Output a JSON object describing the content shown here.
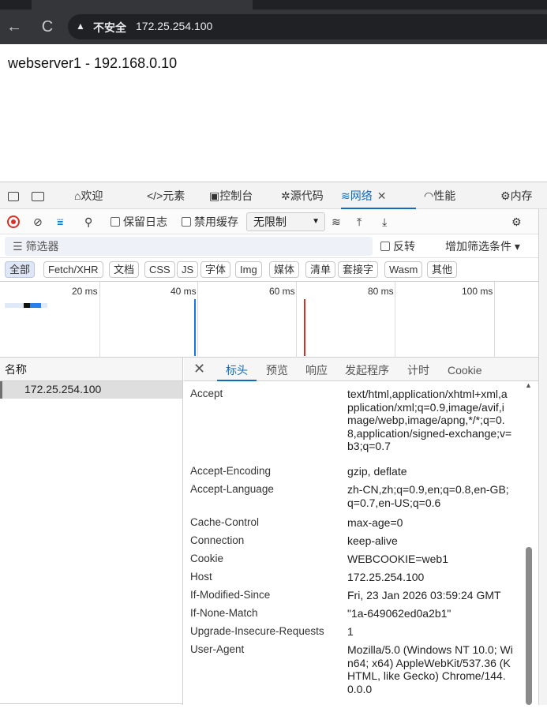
{
  "browser": {
    "back_glyph": "←",
    "reload_glyph": "C",
    "security_label": "不安全",
    "url": "172.25.254.100"
  },
  "page": {
    "text": "webserver1 - 192.168.0.10"
  },
  "devtools": {
    "tabs": [
      {
        "label": "欢迎"
      },
      {
        "label": "元素"
      },
      {
        "label": "控制台"
      },
      {
        "label": "源代码"
      },
      {
        "label": "网络",
        "active": true
      },
      {
        "label": "性能"
      },
      {
        "label": "内存"
      }
    ],
    "toolbar": {
      "preserve_log": "保留日志",
      "disable_cache": "禁用缓存",
      "throttle": "无限制"
    },
    "filter": {
      "placeholder": "筛选器",
      "invert": "反转",
      "more_filters": "增加筛选条件"
    },
    "type_filters": [
      "全部",
      "Fetch/XHR",
      "文档",
      "CSS",
      "JS",
      "字体",
      "Img",
      "媒体",
      "清单",
      "套接字",
      "Wasm",
      "其他"
    ],
    "overview_ticks": [
      "20 ms",
      "40 ms",
      "60 ms",
      "80 ms",
      "100 ms"
    ],
    "name_column_header": "名称",
    "requests": [
      "172.25.254.100"
    ],
    "detail_tabs": [
      "标头",
      "预览",
      "响应",
      "发起程序",
      "计时",
      "Cookie"
    ],
    "active_detail_tab": "标头",
    "headers": [
      {
        "name": "Accept",
        "value": "text/html,application/xhtml+xml,application/xml;q=0.9,image/avif,image/webp,image/apng,*/*;q=0.8,application/signed-exchange;v=b3;q=0.7"
      },
      {
        "name": "Accept-Encoding",
        "value": "gzip, deflate"
      },
      {
        "name": "Accept-Language",
        "value": "zh-CN,zh;q=0.9,en;q=0.8,en-GB;q=0.7,en-US;q=0.6"
      },
      {
        "name": "Cache-Control",
        "value": "max-age=0"
      },
      {
        "name": "Connection",
        "value": "keep-alive"
      },
      {
        "name": "Cookie",
        "value": "WEBCOOKIE=web1"
      },
      {
        "name": "Host",
        "value": "172.25.254.100"
      },
      {
        "name": "If-Modified-Since",
        "value": "Fri, 23 Jan 2026 03:59:24 GMT"
      },
      {
        "name": "If-None-Match",
        "value": "\"1a-649062ed0a2b1\""
      },
      {
        "name": "Upgrade-Insecure-Requests",
        "value": "1"
      },
      {
        "name": "User-Agent",
        "value": "Mozilla/5.0 (Windows NT 10.0; Win64; x64) AppleWebKit/537.36 (KHTML, like Gecko) Chrome/144.0.0.0"
      }
    ]
  }
}
